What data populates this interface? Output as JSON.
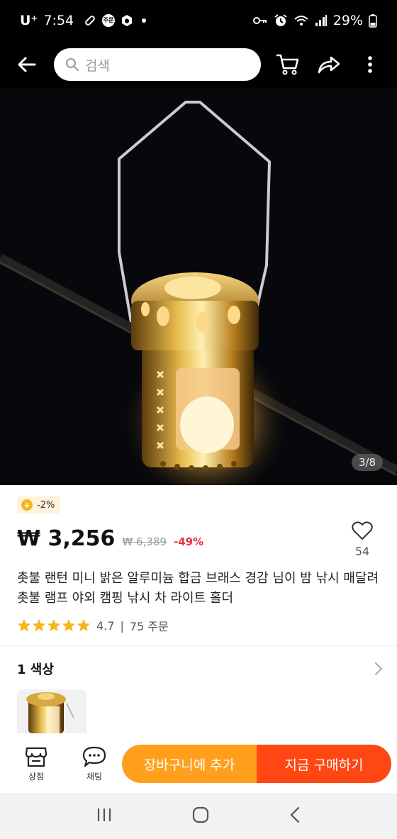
{
  "status_bar": {
    "carrier": "U⁺",
    "time": "7:54",
    "battery": "29%",
    "icons": [
      "pill-icon",
      "notification-badge-icon",
      "cube-icon",
      "key-icon",
      "alarm-icon",
      "wifi-icon",
      "signal-icon",
      "battery-icon"
    ]
  },
  "top_nav": {
    "search_placeholder": "검색",
    "icons": [
      "back-arrow-icon",
      "search-icon",
      "cart-icon",
      "share-icon",
      "more-icon"
    ]
  },
  "hero": {
    "counter": "3/8"
  },
  "product": {
    "discount_badge": "-2%",
    "price": "₩ 3,256",
    "original_price": "₩ 6,389",
    "discount_pct": "-49%",
    "wishlist_count": "54",
    "title": "촛불 랜턴 미니 밝은 알루미늄 합금 브래스 경감 님이 밤 낚시 매달려 촛불 램프 야외 캠핑 낚시 차 라이트 홀더",
    "rating": "4.7",
    "orders": "75 주문",
    "stars": 5
  },
  "variant": {
    "label": "1 색상"
  },
  "action_bar": {
    "store_label": "상점",
    "chat_label": "채팅",
    "add_to_cart_label": "장바구니에 추가",
    "buy_now_label": "지금 구매하기"
  },
  "colors": {
    "accent_orange": "#ff9f1c",
    "accent_red": "#ff4713",
    "discount_red": "#e8303f",
    "star_yellow": "#f7b51d"
  }
}
